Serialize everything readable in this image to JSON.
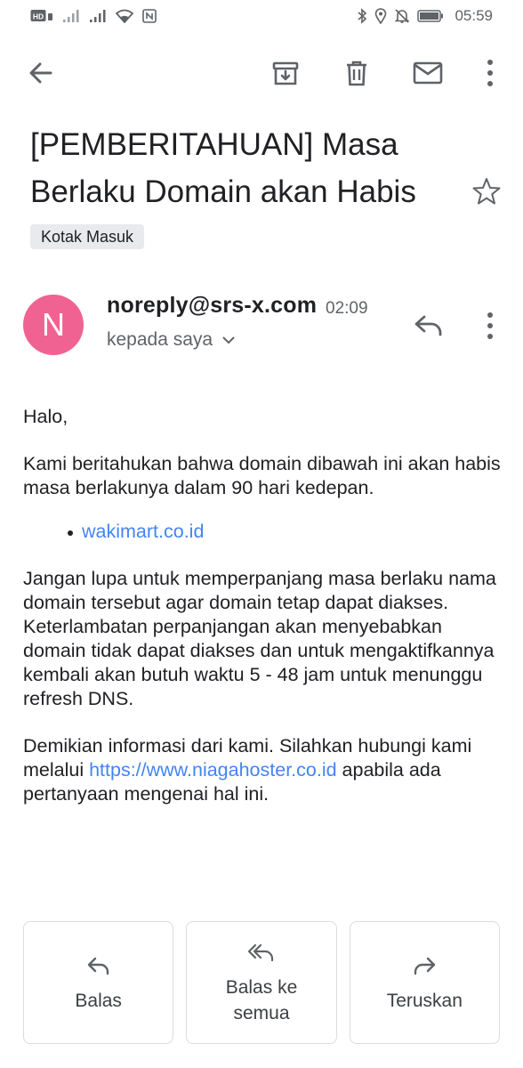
{
  "status_bar": {
    "time": "05:59",
    "hd_badge": "HD"
  },
  "toolbar": {
    "back_icon": "arrow-left-icon",
    "archive_icon": "archive-icon",
    "delete_icon": "trash-icon",
    "mark_unread_icon": "mail-icon",
    "more_icon": "more-vert-icon"
  },
  "email": {
    "subject": "[PEMBERITAHUAN] Masa Berlaku Domain akan Habis",
    "label": "Kotak Masuk",
    "sender": {
      "avatar_letter": "N",
      "avatar_color": "#f06292",
      "address": "noreply@srs-x.com",
      "time": "02:09",
      "recipient": "kepada saya"
    },
    "body": {
      "greeting": "Halo,",
      "para1": "Kami beritahukan bahwa domain dibawah ini akan habis masa berlakunya dalam 90 hari kedepan.",
      "domain": "wakimart.co.id",
      "para2": "Jangan lupa untuk memperpanjang masa berlaku nama domain tersebut agar domain tetap dapat diakses. Keterlambatan perpanjangan akan menyebabkan domain tidak dapat diakses dan untuk mengaktifkannya kembali akan butuh waktu 5 - 48 jam untuk menunggu refresh DNS.",
      "para3_before": "Demikian informasi dari kami. Silahkan hubungi kami melalui ",
      "para3_link": "https://www.niagahoster.co.id",
      "para3_after": " apabila ada pertanyaan mengenai hal ini."
    }
  },
  "actions": {
    "reply": "Balas",
    "reply_all": "Balas ke semua",
    "forward": "Teruskan"
  },
  "colors": {
    "link": "#4285f4",
    "icon": "#5f6368"
  }
}
